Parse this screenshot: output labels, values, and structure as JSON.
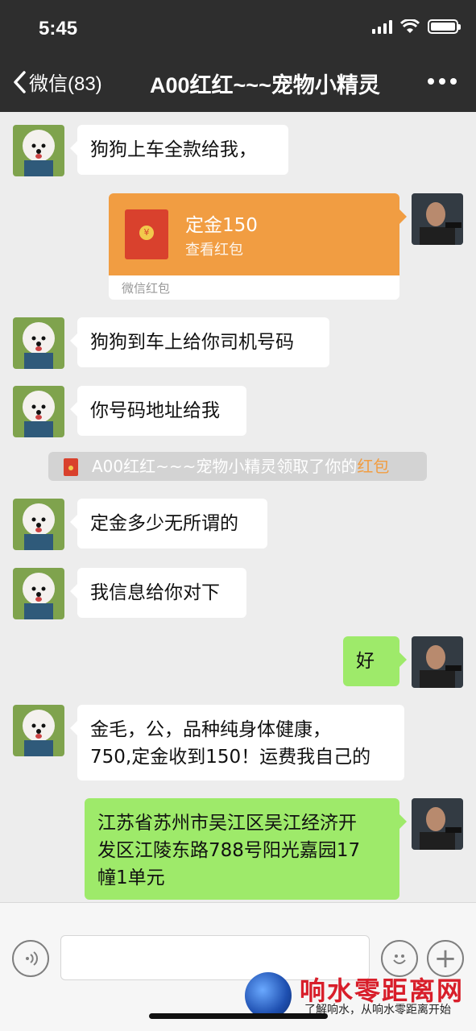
{
  "status_bar": {
    "time": "5:45"
  },
  "nav": {
    "back_label": "微信(83)",
    "title": "A00红红~~~宠物小精灵"
  },
  "messages": [
    {
      "from": "contact",
      "text": "狗狗上车全款给我，"
    },
    {
      "from": "me",
      "type": "red_packet",
      "title": "定金150",
      "action": "查看红包",
      "footer": "微信红包"
    },
    {
      "from": "contact",
      "text": "狗狗到车上给你司机号码"
    },
    {
      "from": "contact",
      "text": "你号码地址给我"
    },
    {
      "type": "system",
      "text": "A00红红~~~宠物小精灵领取了你的",
      "link": "红包"
    },
    {
      "from": "contact",
      "text": "定金多少无所谓的"
    },
    {
      "from": "contact",
      "text": "我信息给你对下"
    },
    {
      "from": "me",
      "text": "好"
    },
    {
      "from": "contact",
      "text_lines": [
        "金毛，公，品种纯身体健康，",
        "750,定金收到150！运费我自己的"
      ]
    },
    {
      "from": "me",
      "text_lines": [
        "江苏省苏州市吴江区吴江经济开",
        "发区江陵东路788号阳光嘉园17",
        "幢1单元"
      ]
    }
  ],
  "input": {
    "placeholder": ""
  },
  "watermark": {
    "title": "响水零距离网",
    "subtitle": "了解响水，从响水零距离开始"
  },
  "colors": {
    "header": "#2e2e2e",
    "chat_bg": "#ededed",
    "outgoing": "#9eea6a",
    "red_packet": "#f19d42"
  }
}
